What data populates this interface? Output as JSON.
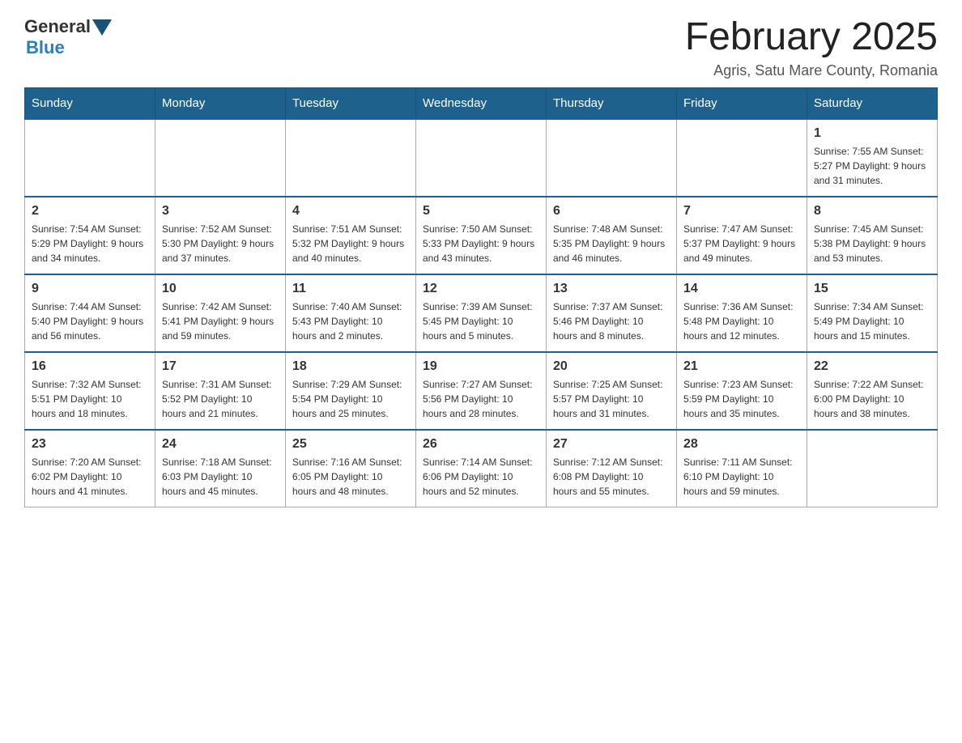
{
  "logo": {
    "general": "General",
    "blue": "Blue"
  },
  "title": "February 2025",
  "subtitle": "Agris, Satu Mare County, Romania",
  "days_of_week": [
    "Sunday",
    "Monday",
    "Tuesday",
    "Wednesday",
    "Thursday",
    "Friday",
    "Saturday"
  ],
  "weeks": [
    [
      {
        "day": "",
        "info": ""
      },
      {
        "day": "",
        "info": ""
      },
      {
        "day": "",
        "info": ""
      },
      {
        "day": "",
        "info": ""
      },
      {
        "day": "",
        "info": ""
      },
      {
        "day": "",
        "info": ""
      },
      {
        "day": "1",
        "info": "Sunrise: 7:55 AM\nSunset: 5:27 PM\nDaylight: 9 hours and 31 minutes."
      }
    ],
    [
      {
        "day": "2",
        "info": "Sunrise: 7:54 AM\nSunset: 5:29 PM\nDaylight: 9 hours and 34 minutes."
      },
      {
        "day": "3",
        "info": "Sunrise: 7:52 AM\nSunset: 5:30 PM\nDaylight: 9 hours and 37 minutes."
      },
      {
        "day": "4",
        "info": "Sunrise: 7:51 AM\nSunset: 5:32 PM\nDaylight: 9 hours and 40 minutes."
      },
      {
        "day": "5",
        "info": "Sunrise: 7:50 AM\nSunset: 5:33 PM\nDaylight: 9 hours and 43 minutes."
      },
      {
        "day": "6",
        "info": "Sunrise: 7:48 AM\nSunset: 5:35 PM\nDaylight: 9 hours and 46 minutes."
      },
      {
        "day": "7",
        "info": "Sunrise: 7:47 AM\nSunset: 5:37 PM\nDaylight: 9 hours and 49 minutes."
      },
      {
        "day": "8",
        "info": "Sunrise: 7:45 AM\nSunset: 5:38 PM\nDaylight: 9 hours and 53 minutes."
      }
    ],
    [
      {
        "day": "9",
        "info": "Sunrise: 7:44 AM\nSunset: 5:40 PM\nDaylight: 9 hours and 56 minutes."
      },
      {
        "day": "10",
        "info": "Sunrise: 7:42 AM\nSunset: 5:41 PM\nDaylight: 9 hours and 59 minutes."
      },
      {
        "day": "11",
        "info": "Sunrise: 7:40 AM\nSunset: 5:43 PM\nDaylight: 10 hours and 2 minutes."
      },
      {
        "day": "12",
        "info": "Sunrise: 7:39 AM\nSunset: 5:45 PM\nDaylight: 10 hours and 5 minutes."
      },
      {
        "day": "13",
        "info": "Sunrise: 7:37 AM\nSunset: 5:46 PM\nDaylight: 10 hours and 8 minutes."
      },
      {
        "day": "14",
        "info": "Sunrise: 7:36 AM\nSunset: 5:48 PM\nDaylight: 10 hours and 12 minutes."
      },
      {
        "day": "15",
        "info": "Sunrise: 7:34 AM\nSunset: 5:49 PM\nDaylight: 10 hours and 15 minutes."
      }
    ],
    [
      {
        "day": "16",
        "info": "Sunrise: 7:32 AM\nSunset: 5:51 PM\nDaylight: 10 hours and 18 minutes."
      },
      {
        "day": "17",
        "info": "Sunrise: 7:31 AM\nSunset: 5:52 PM\nDaylight: 10 hours and 21 minutes."
      },
      {
        "day": "18",
        "info": "Sunrise: 7:29 AM\nSunset: 5:54 PM\nDaylight: 10 hours and 25 minutes."
      },
      {
        "day": "19",
        "info": "Sunrise: 7:27 AM\nSunset: 5:56 PM\nDaylight: 10 hours and 28 minutes."
      },
      {
        "day": "20",
        "info": "Sunrise: 7:25 AM\nSunset: 5:57 PM\nDaylight: 10 hours and 31 minutes."
      },
      {
        "day": "21",
        "info": "Sunrise: 7:23 AM\nSunset: 5:59 PM\nDaylight: 10 hours and 35 minutes."
      },
      {
        "day": "22",
        "info": "Sunrise: 7:22 AM\nSunset: 6:00 PM\nDaylight: 10 hours and 38 minutes."
      }
    ],
    [
      {
        "day": "23",
        "info": "Sunrise: 7:20 AM\nSunset: 6:02 PM\nDaylight: 10 hours and 41 minutes."
      },
      {
        "day": "24",
        "info": "Sunrise: 7:18 AM\nSunset: 6:03 PM\nDaylight: 10 hours and 45 minutes."
      },
      {
        "day": "25",
        "info": "Sunrise: 7:16 AM\nSunset: 6:05 PM\nDaylight: 10 hours and 48 minutes."
      },
      {
        "day": "26",
        "info": "Sunrise: 7:14 AM\nSunset: 6:06 PM\nDaylight: 10 hours and 52 minutes."
      },
      {
        "day": "27",
        "info": "Sunrise: 7:12 AM\nSunset: 6:08 PM\nDaylight: 10 hours and 55 minutes."
      },
      {
        "day": "28",
        "info": "Sunrise: 7:11 AM\nSunset: 6:10 PM\nDaylight: 10 hours and 59 minutes."
      },
      {
        "day": "",
        "info": ""
      }
    ]
  ]
}
